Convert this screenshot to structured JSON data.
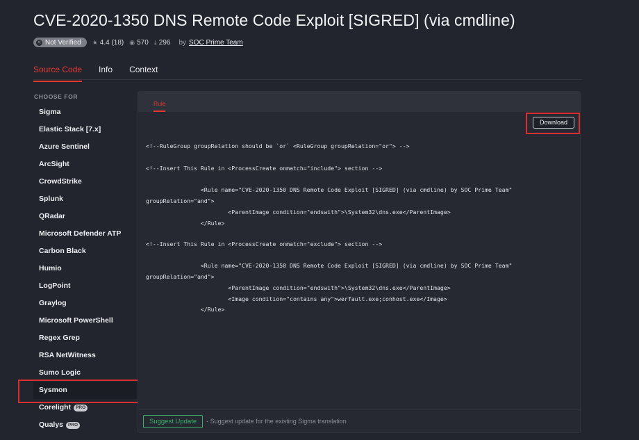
{
  "header": {
    "title": "CVE-2020-1350 DNS Remote Code Exploit [SIGRED] (via cmdline)",
    "verified_badge": "Not Verified",
    "rating": "4.4 (18)",
    "views": "570",
    "downloads": "296",
    "by_label": "by",
    "author": "SOC Prime Team"
  },
  "tabs": [
    "Source Code",
    "Info",
    "Context"
  ],
  "sidebar": {
    "heading": "CHOOSE FOR",
    "items": [
      {
        "label": "Sigma"
      },
      {
        "label": "Elastic Stack [7.x]"
      },
      {
        "label": "Azure Sentinel"
      },
      {
        "label": "ArcSight"
      },
      {
        "label": "CrowdStrike"
      },
      {
        "label": "Splunk"
      },
      {
        "label": "QRadar"
      },
      {
        "label": "Microsoft Defender ATP"
      },
      {
        "label": "Carbon Black"
      },
      {
        "label": "Humio"
      },
      {
        "label": "LogPoint"
      },
      {
        "label": "Graylog"
      },
      {
        "label": "Microsoft PowerShell"
      },
      {
        "label": "Regex Grep"
      },
      {
        "label": "RSA NetWitness"
      },
      {
        "label": "Sumo Logic"
      },
      {
        "label": "Sysmon"
      },
      {
        "label": "Corelight",
        "tag": "PRO"
      },
      {
        "label": "Qualys",
        "tag": "PRO"
      }
    ],
    "selected": "Sysmon"
  },
  "panel": {
    "tab": "Rule",
    "download_label": "Download",
    "code_lines": [
      "<!--RuleGroup groupRelation should be `or` <RuleGroup groupRelation=\"or\"> -->",
      "<!--Insert This Rule in <ProcessCreate onmatch=\"include\"> section -->",
      "                <Rule name=\"CVE-2020-1350 DNS Remote Code Exploit [SIGRED] (via cmdline) by SOC Prime Team\"",
      "groupRelation=\"and\">",
      "                        <ParentImage condition=\"endswith\">\\System32\\dns.exe</ParentImage>",
      "                </Rule>",
      "<!--Insert This Rule in <ProcessCreate onmatch=\"exclude\"> section -->",
      "                <Rule name=\"CVE-2020-1350 DNS Remote Code Exploit [SIGRED] (via cmdline) by SOC Prime Team\"",
      "groupRelation=\"and\">",
      "                        <ParentImage condition=\"endswith\">\\System32\\dns.exe</ParentImage>",
      "                        <Image condition=\"contains any\">werfault.exe;conhost.exe</Image>",
      "                </Rule>"
    ]
  },
  "footer": {
    "suggest_label": "Suggest Update",
    "note": "- Suggest update for the existing Sigma translation"
  },
  "colors": {
    "background": "#23252e",
    "accent_red": "#e5392f",
    "highlight_red": "#d9302f",
    "suggest_green": "#39b36a"
  },
  "icons": {
    "verified": "x-circle-icon",
    "rating": "star-icon",
    "views": "eye-icon",
    "downloads": "download-icon"
  }
}
